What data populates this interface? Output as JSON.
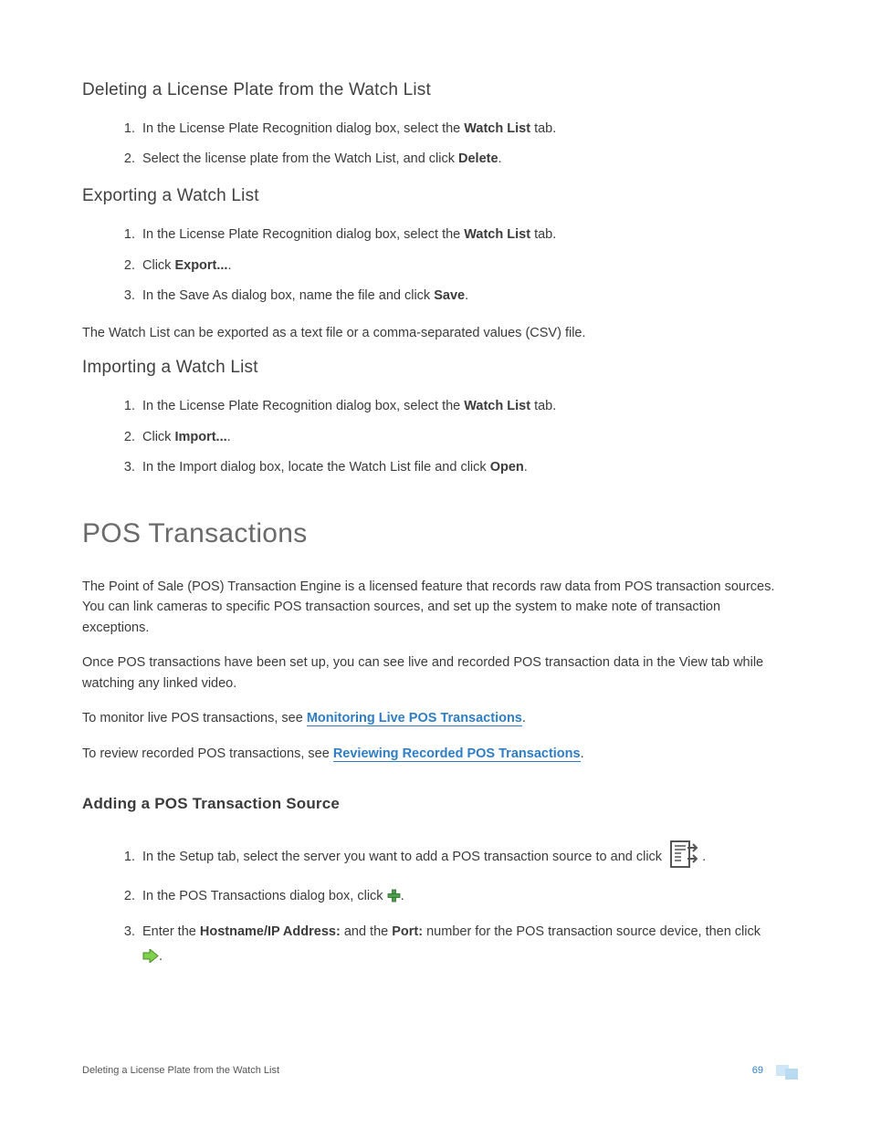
{
  "sections": {
    "delete": {
      "title": "Deleting a License Plate from the Watch List",
      "steps": [
        {
          "pre": "In the License Plate Recognition dialog box, select the ",
          "bold": "Watch List",
          "post": " tab."
        },
        {
          "pre": "Select the license plate from the Watch List, and click ",
          "bold": "Delete",
          "post": "."
        }
      ]
    },
    "export": {
      "title": "Exporting a Watch List",
      "steps": [
        {
          "pre": "In the License Plate Recognition dialog box, select the ",
          "bold": "Watch List",
          "post": " tab."
        },
        {
          "pre": "Click ",
          "bold": "Export...",
          "post": "."
        },
        {
          "pre": "In the Save As dialog box, name the file and click ",
          "bold": "Save",
          "post": "."
        }
      ],
      "after": "The Watch List can be exported as a text file or a comma-separated values (CSV) file."
    },
    "import": {
      "title": "Importing a Watch List",
      "steps": [
        {
          "pre": "In the License Plate Recognition dialog box, select the ",
          "bold": "Watch List",
          "post": " tab."
        },
        {
          "pre": "Click ",
          "bold": "Import...",
          "post": "."
        },
        {
          "pre": "In the Import dialog box, locate the Watch List file and click ",
          "bold": "Open",
          "post": "."
        }
      ]
    },
    "pos": {
      "title": "POS Transactions",
      "p1": "The Point of Sale (POS) Transaction Engine is a licensed feature that records raw data from POS transaction sources. You can link cameras to specific POS transaction sources, and set up the system to make note of transaction exceptions.",
      "p2": "Once POS transactions have been set up, you can see live and recorded POS transaction data in the View tab while watching any linked video.",
      "p3_pre": "To monitor live POS transactions, see  ",
      "p3_link": "Monitoring Live POS Transactions",
      "p3_post": ".",
      "p4_pre": "To review recorded POS transactions, see ",
      "p4_link": "Reviewing Recorded POS Transactions",
      "p4_post": "."
    },
    "addpos": {
      "title": "Adding a POS Transaction Source",
      "step1_pre": "In the Setup tab, select the server you want to add a POS transaction source to and click ",
      "step1_post": " .",
      "step2_pre": "In the POS Transactions dialog box, click ",
      "step2_post": ".",
      "step3_pre": "Enter the ",
      "step3_b1": "Hostname/IP Address:",
      "step3_mid": " and the ",
      "step3_b2": "Port:",
      "step3_post": " number for the POS transaction source device, then click ",
      "step3_end": "."
    }
  },
  "footer": {
    "left": "Deleting a License Plate from the Watch List",
    "page": "69"
  }
}
